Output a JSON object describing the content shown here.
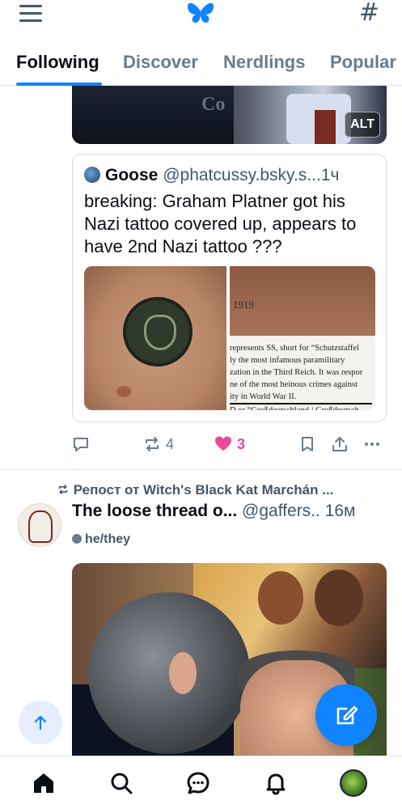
{
  "header": {
    "menu_icon": "hamburger-icon",
    "logo_icon": "butterfly-logo",
    "hashtag_icon": "hashtag-icon",
    "hashtag_glyph": "#"
  },
  "tabs": [
    {
      "label": "Following",
      "active": true
    },
    {
      "label": "Discover",
      "active": false
    },
    {
      "label": "Nerdlings",
      "active": false
    },
    {
      "label": "Popular",
      "active": false
    }
  ],
  "post1": {
    "image_alt_badge": "ALT",
    "image_partial_text": "Co",
    "quote": {
      "author_name": "Goose",
      "author_handle": "@phatcussy.bsky.s...",
      "time": "1ч",
      "text": "breaking: Graham Platner got his Nazi tattoo covered up, appears to have 2nd Nazi tattoo ???",
      "image2_number": "1919",
      "image2_lines": [
        "represents SS, short for “Schutzstaffel",
        "ly the most infamous paramilitary",
        "zation in the Third Reich. It was respor",
        "ne of the most heinous crimes against",
        "ity in World War II.",
        "D or “Großdeutschland / Großdeutsch"
      ]
    },
    "actions": {
      "reply_count": "",
      "repost_count": "4",
      "like_count": "3"
    }
  },
  "post2": {
    "repost_label": "Репост от Witch's Black Kat Marchán ...",
    "author_name": "The loose thread o...",
    "author_handle": "@gaffers..",
    "time": "16м",
    "pronouns": "he/they"
  },
  "bottom_nav": [
    {
      "name": "home",
      "icon": "home-icon"
    },
    {
      "name": "search",
      "icon": "search-icon"
    },
    {
      "name": "chat",
      "icon": "chat-icon"
    },
    {
      "name": "notifications",
      "icon": "bell-icon"
    },
    {
      "name": "profile",
      "icon": "avatar"
    }
  ],
  "colors": {
    "accent": "#1083fe",
    "like": "#ec4899",
    "muted": "#6b7b8c"
  }
}
